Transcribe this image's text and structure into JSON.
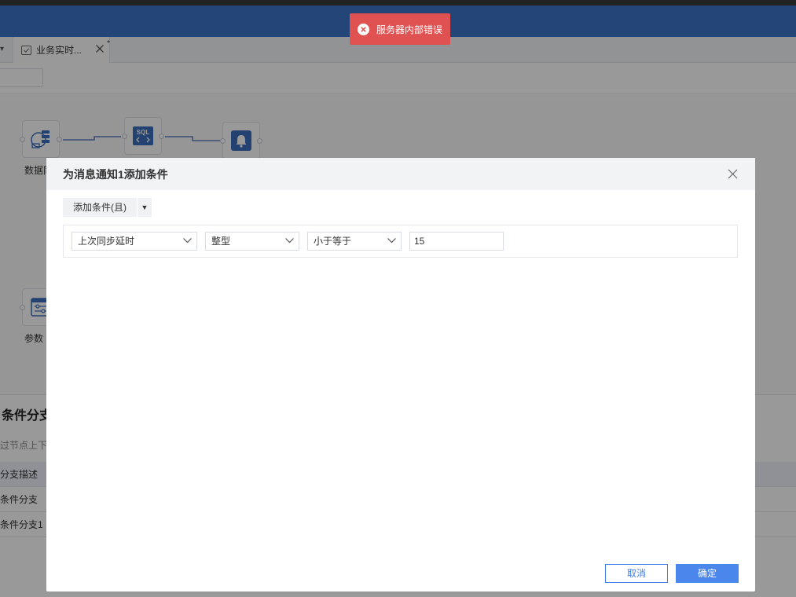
{
  "tabs": [
    {
      "label": "业务实时...",
      "modified": "*"
    }
  ],
  "canvas": {
    "nodes": [
      {
        "label": "数据同",
        "icon": "database-sync-icon"
      },
      {
        "label": "",
        "icon": "sql-icon",
        "icon_text": "SQL"
      },
      {
        "label": "",
        "icon": "bell-icon"
      },
      {
        "label": "参数",
        "icon": "parameters-icon"
      }
    ]
  },
  "panel": {
    "title": "条件分支",
    "subtitle": "过节点上下游",
    "table_header": "分支描述",
    "rows": [
      "条件分支",
      "条件分支1"
    ]
  },
  "dialog": {
    "title": "为消息通知1添加条件",
    "add_condition_label": "添加条件(且)",
    "condition": {
      "field": "上次同步延时",
      "type": "整型",
      "operator": "小于等于",
      "value": "15"
    },
    "cancel_label": "取消",
    "ok_label": "确定"
  },
  "toast": {
    "message": "服务器内部错误",
    "color": "#e05252"
  },
  "colors": {
    "header": "#3d74c8",
    "primary": "#4a86ec"
  }
}
